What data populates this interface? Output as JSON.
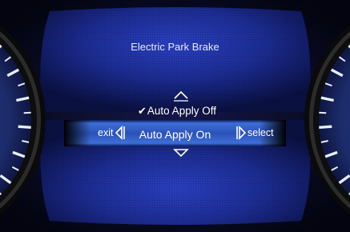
{
  "menu": {
    "title": "Electric Park Brake",
    "options": [
      {
        "label": "Auto Apply Off",
        "checked": true
      },
      {
        "label": "Auto Apply On",
        "highlighted": true
      }
    ],
    "check_icon": "checkmark-icon",
    "up_icon": "up-arrow-icon",
    "down_icon": "down-arrow-icon"
  },
  "controls": {
    "exit_label": "exit",
    "select_label": "select",
    "left_icon": "left-arrow-icon",
    "right_icon": "right-arrow-icon"
  },
  "colors": {
    "display_blue": "#1d2f94",
    "highlight_bar": "#3e6fd6",
    "bezel": "#111111",
    "gauge_face": "#1f2f72",
    "text": "#ffffff"
  }
}
